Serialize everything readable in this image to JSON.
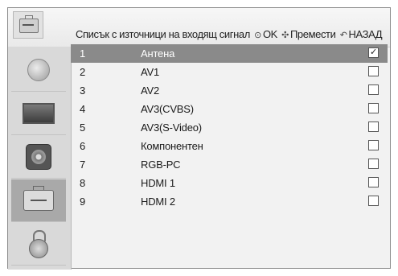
{
  "header": {
    "title": "Списък с източници на входящ сигнал",
    "ok_symbol": "⊙",
    "ok_label": "OK",
    "move_symbol": "✣",
    "move_label": "Премести",
    "back_symbol": "↶",
    "back_label": "НАЗАД"
  },
  "sidebar": {
    "items": [
      {
        "icon": "satellite-dish-icon",
        "active": false
      },
      {
        "icon": "tv-icon",
        "active": false
      },
      {
        "icon": "speaker-icon",
        "active": false
      },
      {
        "icon": "toolbox-icon",
        "active": true
      },
      {
        "icon": "lock-icon",
        "active": false
      }
    ]
  },
  "sources": [
    {
      "num": "1",
      "name": "Антена",
      "checked": true,
      "check_mark": "✓"
    },
    {
      "num": "2",
      "name": "AV1",
      "checked": false,
      "check_mark": ""
    },
    {
      "num": "3",
      "name": "AV2",
      "checked": false,
      "check_mark": ""
    },
    {
      "num": "4",
      "name": "AV3(CVBS)",
      "checked": false,
      "check_mark": ""
    },
    {
      "num": "5",
      "name": "AV3(S-Video)",
      "checked": false,
      "check_mark": ""
    },
    {
      "num": "6",
      "name": "Компонентен",
      "checked": false,
      "check_mark": ""
    },
    {
      "num": "7",
      "name": "RGB-PC",
      "checked": false,
      "check_mark": ""
    },
    {
      "num": "8",
      "name": "HDMI 1",
      "checked": false,
      "check_mark": ""
    },
    {
      "num": "9",
      "name": "HDMI 2",
      "checked": false,
      "check_mark": ""
    }
  ],
  "selected_index": 0,
  "colors": {
    "selected_row": "#8a8a8a",
    "sidebar_active": "#a9a9a9",
    "panel": "#f2f2f2"
  }
}
